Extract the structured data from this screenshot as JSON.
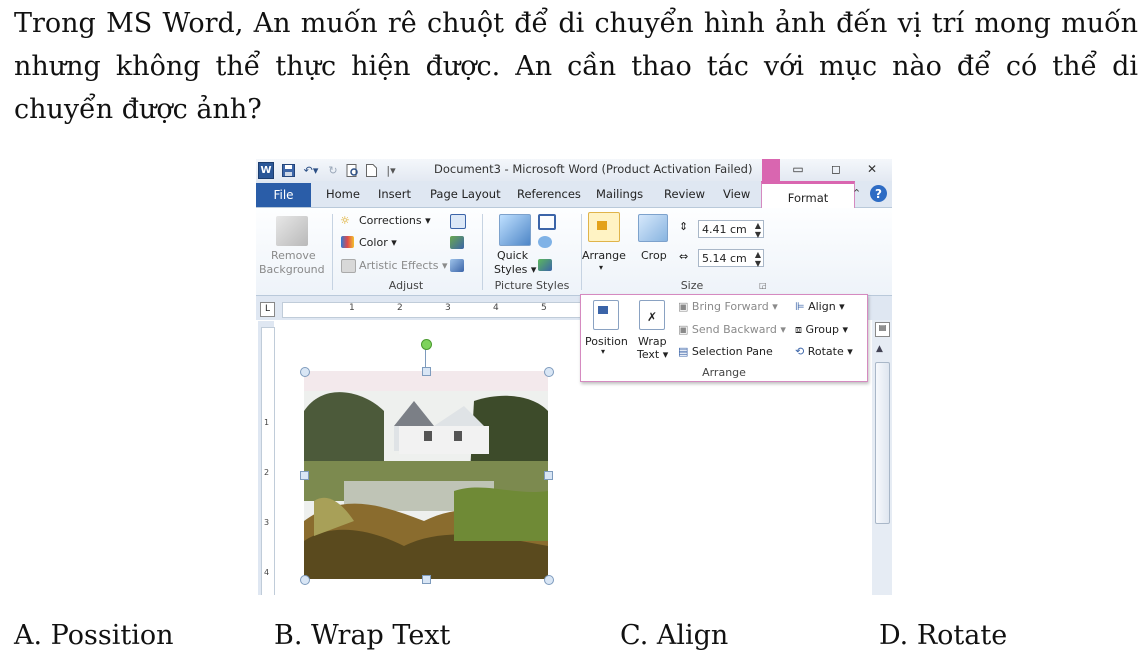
{
  "question": "Trong MS Word, An muốn rê chuột để di chuyển hình ảnh đến vị trí mong muốn nhưng không thể thực hiện được. An cần thao tác với mục nào để có thể di chuyển được ảnh?",
  "options": [
    "A. Possition",
    "B. Wrap Text",
    "C. Align",
    "D. Rotate"
  ],
  "word": {
    "title": "Document3 - Microsoft Word (Product Activation Failed)",
    "logo": "W",
    "tabs": {
      "file": "File",
      "home": "Home",
      "insert": "Insert",
      "page_layout": "Page Layout",
      "references": "References",
      "mailings": "Mailings",
      "review": "Review",
      "view": "View",
      "format": "Format"
    },
    "help": "?",
    "ribbon": {
      "remove_bg_1": "Remove",
      "remove_bg_2": "Background",
      "corrections": "Corrections",
      "color": "Color",
      "artistic_effects": "Artistic Effects",
      "adjust": "Adjust",
      "quick_styles_1": "Quick",
      "quick_styles_2": "Styles",
      "picture_styles": "Picture Styles",
      "arrange": "Arrange",
      "crop": "Crop",
      "height": "4.41 cm",
      "width": "5.14 cm",
      "size": "Size"
    },
    "arrange_menu": {
      "position": "Position",
      "wrap_1": "Wrap",
      "wrap_2": "Text",
      "bring_forward": "Bring Forward",
      "send_backward": "Send Backward",
      "selection_pane": "Selection Pane",
      "align": "Align",
      "group": "Group",
      "rotate": "Rotate",
      "label": "Arrange"
    },
    "ruler": {
      "h": [
        "1",
        "2",
        "3",
        "4",
        "5"
      ],
      "v": [
        "1",
        "2",
        "3",
        "4"
      ]
    }
  },
  "colors": {
    "file_tab": "#2a5da8",
    "format_accent": "#d966b0",
    "ribbon_bg": "#eef3f9"
  }
}
